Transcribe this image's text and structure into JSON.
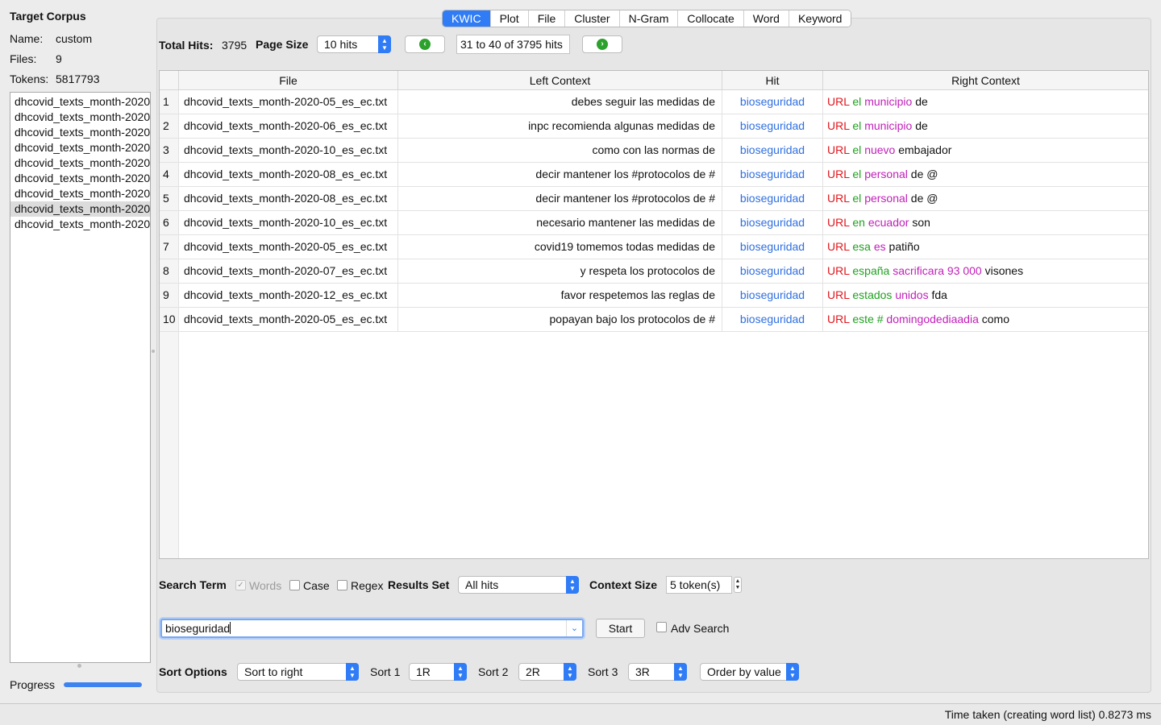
{
  "sidebar": {
    "title": "Target Corpus",
    "name_label": "Name:",
    "name_value": "custom",
    "files_label": "Files:",
    "files_value": "9",
    "tokens_label": "Tokens:",
    "tokens_value": "5817793",
    "files": [
      "dhcovid_texts_month-2020",
      "dhcovid_texts_month-2020",
      "dhcovid_texts_month-2020",
      "dhcovid_texts_month-2020",
      "dhcovid_texts_month-2020",
      "dhcovid_texts_month-2020",
      "dhcovid_texts_month-2020",
      "dhcovid_texts_month-2020",
      "dhcovid_texts_month-2020"
    ],
    "selected_file_index": 7,
    "progress_label": "Progress",
    "progress_fraction": 1.0
  },
  "tabs": [
    "KWIC",
    "Plot",
    "File",
    "Cluster",
    "N-Gram",
    "Collocate",
    "Word",
    "Keyword"
  ],
  "active_tab": "KWIC",
  "toolbar": {
    "total_hits_label": "Total Hits:",
    "total_hits_value": "3795",
    "page_size_label": "Page Size",
    "page_size_value": "10 hits",
    "range_text": "31 to 40 of 3795 hits",
    "prev_icon": "arrow-left-circle-icon",
    "next_icon": "arrow-right-circle-icon"
  },
  "table": {
    "columns": [
      "File",
      "Left Context",
      "Hit",
      "Right Context"
    ],
    "rows": [
      {
        "idx": "1",
        "file": "dhcovid_texts_month-2020-05_es_ec.txt",
        "left": "debes seguir las medidas de",
        "hit": "bioseguridad",
        "right": [
          {
            "w": "URL",
            "c": "red"
          },
          {
            "w": "el",
            "c": "green"
          },
          {
            "w": "municipio",
            "c": "magenta"
          },
          {
            "w": "de",
            "c": "black"
          }
        ]
      },
      {
        "idx": "2",
        "file": "dhcovid_texts_month-2020-06_es_ec.txt",
        "left": "inpc recomienda algunas medidas de",
        "hit": "bioseguridad",
        "right": [
          {
            "w": "URL",
            "c": "red"
          },
          {
            "w": "el",
            "c": "green"
          },
          {
            "w": "municipio",
            "c": "magenta"
          },
          {
            "w": "de",
            "c": "black"
          }
        ]
      },
      {
        "idx": "3",
        "file": "dhcovid_texts_month-2020-10_es_ec.txt",
        "left": "como con las normas de",
        "hit": "bioseguridad",
        "right": [
          {
            "w": "URL",
            "c": "red"
          },
          {
            "w": "el",
            "c": "green"
          },
          {
            "w": "nuevo",
            "c": "magenta"
          },
          {
            "w": "embajador",
            "c": "black"
          }
        ]
      },
      {
        "idx": "4",
        "file": "dhcovid_texts_month-2020-08_es_ec.txt",
        "left": "decir mantener los #protocolos de #",
        "hit": "bioseguridad",
        "right": [
          {
            "w": "URL",
            "c": "red"
          },
          {
            "w": "el",
            "c": "green"
          },
          {
            "w": "personal",
            "c": "magenta"
          },
          {
            "w": "de @",
            "c": "black"
          }
        ]
      },
      {
        "idx": "5",
        "file": "dhcovid_texts_month-2020-08_es_ec.txt",
        "left": "decir mantener los #protocolos de #",
        "hit": "bioseguridad",
        "right": [
          {
            "w": "URL",
            "c": "red"
          },
          {
            "w": "el",
            "c": "green"
          },
          {
            "w": "personal",
            "c": "magenta"
          },
          {
            "w": "de @",
            "c": "black"
          }
        ]
      },
      {
        "idx": "6",
        "file": "dhcovid_texts_month-2020-10_es_ec.txt",
        "left": "necesario mantener las medidas de",
        "hit": "bioseguridad",
        "right": [
          {
            "w": "URL",
            "c": "red"
          },
          {
            "w": "en",
            "c": "green"
          },
          {
            "w": "ecuador",
            "c": "magenta"
          },
          {
            "w": "son",
            "c": "black"
          }
        ]
      },
      {
        "idx": "7",
        "file": "dhcovid_texts_month-2020-05_es_ec.txt",
        "left": "covid19 tomemos todas medidas de",
        "hit": "bioseguridad",
        "right": [
          {
            "w": "URL",
            "c": "red"
          },
          {
            "w": "esa",
            "c": "green"
          },
          {
            "w": "es",
            "c": "magenta"
          },
          {
            "w": "patiño",
            "c": "black"
          }
        ]
      },
      {
        "idx": "8",
        "file": "dhcovid_texts_month-2020-07_es_ec.txt",
        "left": "y respeta los protocolos de",
        "hit": "bioseguridad",
        "right": [
          {
            "w": "URL",
            "c": "red"
          },
          {
            "w": "españa",
            "c": "green"
          },
          {
            "w": "sacrificara 93 000",
            "c": "magenta"
          },
          {
            "w": "visones",
            "c": "black"
          }
        ]
      },
      {
        "idx": "9",
        "file": "dhcovid_texts_month-2020-12_es_ec.txt",
        "left": "favor respetemos las reglas de",
        "hit": "bioseguridad",
        "right": [
          {
            "w": "URL",
            "c": "red"
          },
          {
            "w": "estados",
            "c": "green"
          },
          {
            "w": "unidos",
            "c": "magenta"
          },
          {
            "w": "fda",
            "c": "black"
          }
        ]
      },
      {
        "idx": "10",
        "file": "dhcovid_texts_month-2020-05_es_ec.txt",
        "left": "popayan bajo los protocolos de #",
        "hit": "bioseguridad",
        "right": [
          {
            "w": "URL",
            "c": "red"
          },
          {
            "w": "este #",
            "c": "green"
          },
          {
            "w": "domingodediaadia",
            "c": "magenta"
          },
          {
            "w": "como",
            "c": "black"
          }
        ]
      }
    ]
  },
  "search": {
    "search_term_label": "Search Term",
    "words_label": "Words",
    "words_checked": true,
    "case_label": "Case",
    "regex_label": "Regex",
    "results_set_label": "Results Set",
    "results_set_value": "All hits",
    "context_size_label": "Context Size",
    "context_size_value": "5 token(s)",
    "query": "bioseguridad",
    "start_label": "Start",
    "adv_search_label": "Adv Search"
  },
  "sort": {
    "label": "Sort Options",
    "mode_value": "Sort to right",
    "sort1_label": "Sort 1",
    "sort1_value": "1R",
    "sort2_label": "Sort 2",
    "sort2_value": "2R",
    "sort3_label": "Sort 3",
    "sort3_value": "3R",
    "order_value": "Order by value"
  },
  "status": {
    "text": "Time taken (creating word list) 0.8273 ms"
  },
  "colors": {
    "accent": "#2f7cf6",
    "hit": "#2f6fe0",
    "red": "#e0161c",
    "green": "#20a020",
    "magenta": "#c01fb8"
  }
}
